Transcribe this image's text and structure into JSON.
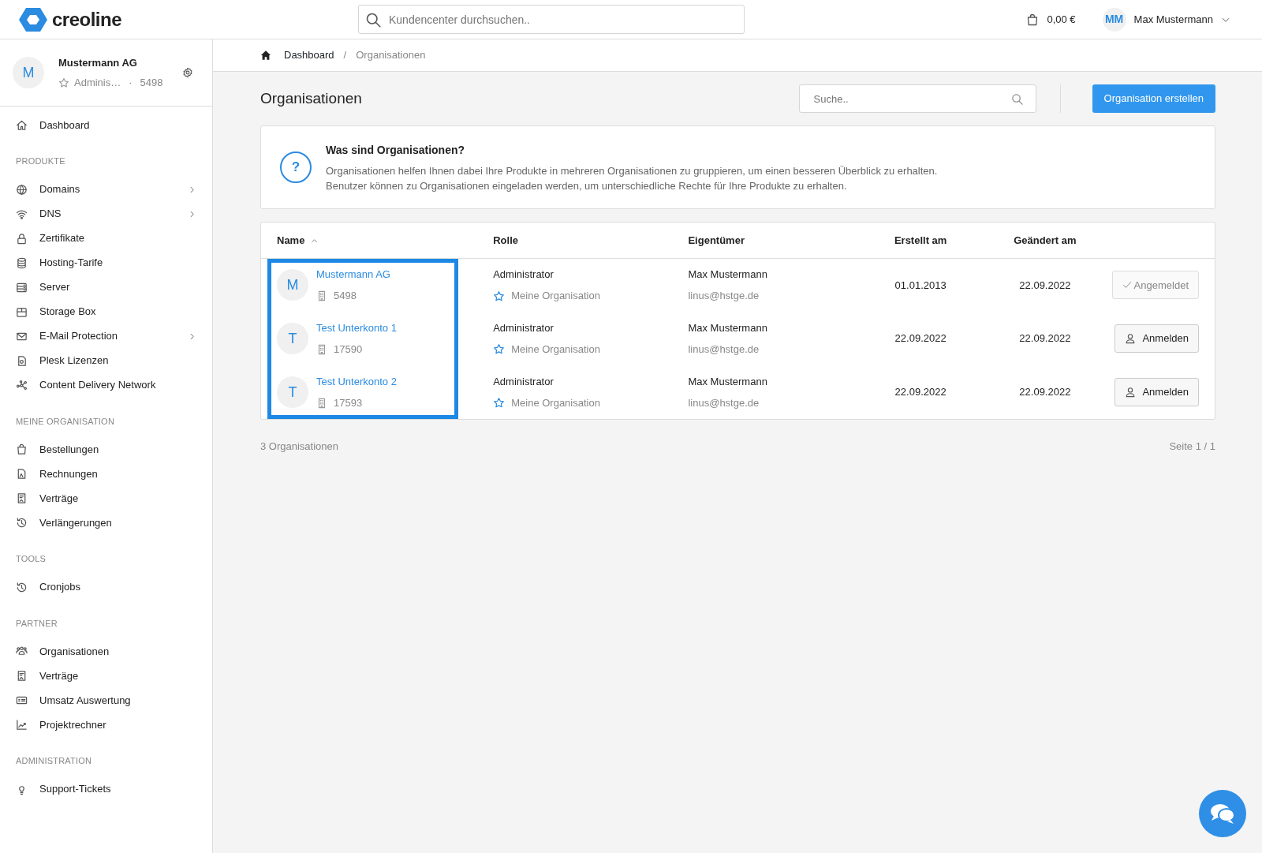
{
  "header": {
    "logo_text": "creoline",
    "search": {
      "placeholder": "Kundencenter durchsuchen.."
    },
    "cart_total": "0,00 €",
    "user": {
      "initials": "MM",
      "name": "Max Mustermann"
    }
  },
  "sidebar": {
    "account": {
      "initial": "M",
      "name": "Mustermann AG",
      "role": "Adminis…",
      "separator": "·",
      "number": "5498"
    },
    "groups": [
      {
        "items": [
          {
            "label": "Dashboard",
            "has_submenu": false
          }
        ]
      },
      {
        "heading": "PRODUKTE",
        "items": [
          {
            "label": "Domains",
            "has_submenu": true
          },
          {
            "label": "DNS",
            "has_submenu": true
          },
          {
            "label": "Zertifikate",
            "has_submenu": false
          },
          {
            "label": "Hosting-Tarife",
            "has_submenu": false
          },
          {
            "label": "Server",
            "has_submenu": false
          },
          {
            "label": "Storage Box",
            "has_submenu": false
          },
          {
            "label": "E-Mail Protection",
            "has_submenu": true
          },
          {
            "label": "Plesk Lizenzen",
            "has_submenu": false
          },
          {
            "label": "Content Delivery Network",
            "has_submenu": false
          }
        ]
      },
      {
        "heading": "MEINE ORGANISATION",
        "items": [
          {
            "label": "Bestellungen",
            "has_submenu": false
          },
          {
            "label": "Rechnungen",
            "has_submenu": false
          },
          {
            "label": "Verträge",
            "has_submenu": false
          },
          {
            "label": "Verlängerungen",
            "has_submenu": false
          }
        ]
      },
      {
        "heading": "TOOLS",
        "items": [
          {
            "label": "Cronjobs",
            "has_submenu": false
          }
        ]
      },
      {
        "heading": "PARTNER",
        "items": [
          {
            "label": "Organisationen",
            "has_submenu": false
          },
          {
            "label": "Verträge",
            "has_submenu": false
          },
          {
            "label": "Umsatz Auswertung",
            "has_submenu": false
          },
          {
            "label": "Projektrechner",
            "has_submenu": false
          }
        ]
      },
      {
        "heading": "ADMINISTRATION",
        "items": [
          {
            "label": "Support-Tickets",
            "has_submenu": false
          }
        ]
      }
    ]
  },
  "breadcrumb": [
    {
      "label": "Dashboard",
      "current": false
    },
    {
      "label": "Organisationen",
      "current": true
    }
  ],
  "breadcrumb_separator": "/",
  "page_title": "Organisationen",
  "search": {
    "placeholder": "Suche.."
  },
  "create_button": "Organisation erstellen",
  "info": {
    "icon_text": "?",
    "title": "Was sind Organisationen?",
    "lines": [
      "Organisationen helfen Ihnen dabei Ihre Produkte in mehreren Organisationen zu gruppieren, um einen besseren Überblick zu erhalten.",
      "Benutzer können zu Organisationen eingeladen werden, um unterschiedliche Rechte für Ihre Produkte zu erhalten."
    ]
  },
  "table": {
    "name_column_highlighted": true,
    "columns": [
      {
        "label": "Name",
        "sorted": true
      },
      {
        "label": "Rolle",
        "sorted": false
      },
      {
        "label": "Eigentümer",
        "sorted": false
      },
      {
        "label": "Erstellt am",
        "sorted": false
      },
      {
        "label": "Geändert am",
        "sorted": false
      }
    ],
    "rows": [
      {
        "initial": "M",
        "name": "Mustermann AG",
        "number": "5498",
        "role": "Administrator",
        "org_tag": "Meine Organisation",
        "owner": "Max Mustermann",
        "email": "linus@hstge.de",
        "created": "01.01.2013",
        "changed": "22.09.2022",
        "action": {
          "label": "Angemeldet",
          "kind": "signed_in",
          "disabled": true
        }
      },
      {
        "initial": "T",
        "name": "Test Unterkonto 1",
        "number": "17590",
        "role": "Administrator",
        "org_tag": "Meine Organisation",
        "owner": "Max Mustermann",
        "email": "linus@hstge.de",
        "created": "22.09.2022",
        "changed": "22.09.2022",
        "action": {
          "label": "Anmelden",
          "kind": "login",
          "disabled": false
        }
      },
      {
        "initial": "T",
        "name": "Test Unterkonto 2",
        "number": "17593",
        "role": "Administrator",
        "org_tag": "Meine Organisation",
        "owner": "Max Mustermann",
        "email": "linus@hstge.de",
        "created": "22.09.2022",
        "changed": "22.09.2022",
        "action": {
          "label": "Anmelden",
          "kind": "login",
          "disabled": false
        }
      }
    ]
  },
  "footer": {
    "count": "3 Organisationen",
    "pagination": "Seite 1 / 1"
  }
}
